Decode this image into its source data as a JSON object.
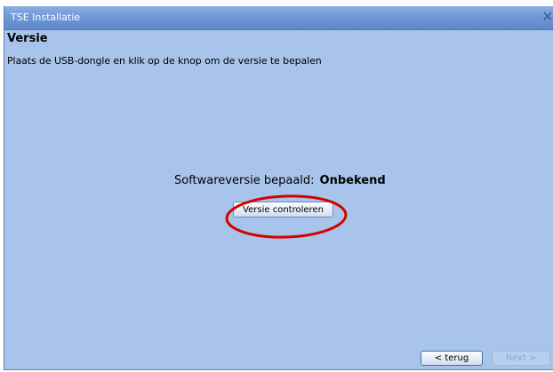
{
  "window": {
    "title": "TSE Installatie",
    "close_symbol": "✕"
  },
  "page": {
    "heading": "Versie",
    "subtitle": "Plaats de USB-dongle en klik op de knop om de versie te bepalen"
  },
  "version": {
    "label": "Softwareversie bepaald:",
    "value": "Onbekend"
  },
  "buttons": {
    "check_label": "Versie controleren",
    "back_label": "< terug",
    "next_label": "Next >"
  },
  "annotation": {
    "color": "#d40000"
  }
}
